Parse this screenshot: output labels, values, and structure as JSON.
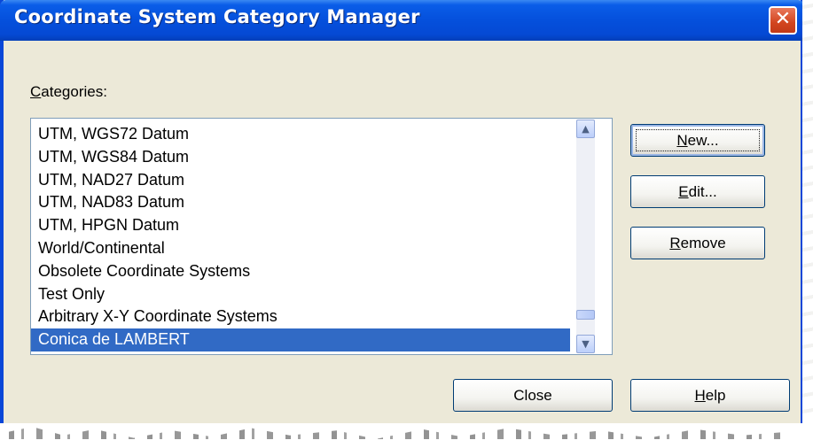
{
  "dialog": {
    "title": "Coordinate System Category Manager",
    "close_glyph": "✕",
    "categories_label_mnemonic": "C",
    "categories_label_rest": "ategories:",
    "categories": [
      "UTM, WGS72 Datum",
      "UTM, WGS84 Datum",
      "UTM, NAD27 Datum",
      "UTM, NAD83 Datum",
      "UTM, HPGN Datum",
      "World/Continental",
      "Obsolete Coordinate Systems",
      "Test Only",
      "Arbitrary X-Y Coordinate Systems",
      "Conica de LAMBERT"
    ],
    "selected_category": "Conica de LAMBERT",
    "buttons": {
      "new_mnemonic": "N",
      "new_rest": "ew...",
      "edit_mnemonic": "E",
      "edit_rest": "dit...",
      "remove_mnemonic": "R",
      "remove_rest": "emove",
      "close": "Close",
      "help_mnemonic": "H",
      "help_rest": "elp"
    },
    "scrollbar": {
      "up_glyph": "▲",
      "down_glyph": "▼"
    }
  },
  "colors": {
    "titlebar": "#0550dc",
    "dialog_bg": "#ece9d8",
    "selection": "#316ac5",
    "close_button": "#d2451f"
  },
  "icons": [
    "close-icon",
    "scroll-up-icon",
    "scroll-down-icon"
  ]
}
